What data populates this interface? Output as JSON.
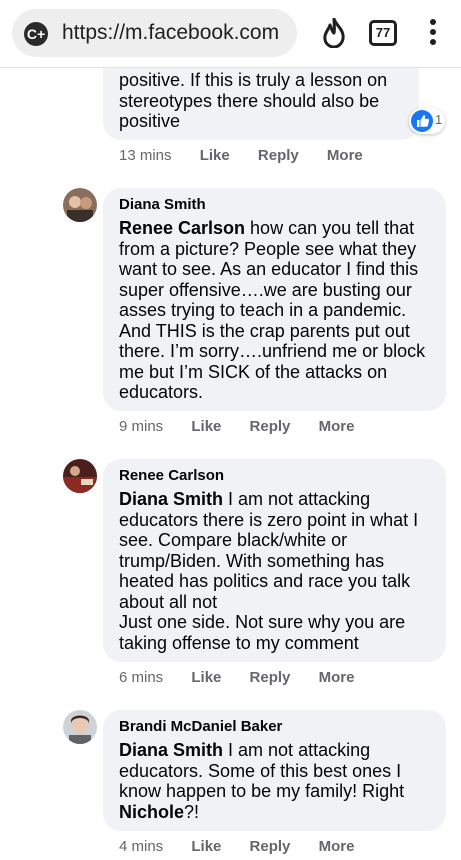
{
  "browser": {
    "site_badge": "C+",
    "url": "https://m.facebook.com",
    "tab_count": "77",
    "icons": [
      "site-badge-icon",
      "flame-icon",
      "tabs-icon",
      "kebab-menu-icon"
    ]
  },
  "comments": [
    {
      "author": "",
      "lines": [
        "positive. If this is truly a lesson on",
        "stereotypes there should also be",
        "positive"
      ],
      "time": "13 mins",
      "like": "Like",
      "reply": "Reply",
      "more": "More",
      "reaction_count": "1"
    },
    {
      "author": "Diana Smith",
      "mention": "Renee Carlson",
      "lines": [
        " how can you tell that",
        "from a picture? People see what they",
        "want to see. As an educator I find this",
        "super offensive….we are busting our",
        "asses trying to teach in a pandemic.",
        "And THIS is the crap parents put out",
        "there. I’m sorry….unfriend me or block",
        "me but I’m SICK of the attacks on",
        "educators."
      ],
      "time": "9 mins",
      "like": "Like",
      "reply": "Reply",
      "more": "More"
    },
    {
      "author": "Renee Carlson",
      "mention": "Diana Smith",
      "lines": [
        " I am not attacking",
        "educators there is zero point in what I",
        "see. Compare black/white or",
        "trump/Biden. With something has",
        "heated has politics and race you talk",
        "about all not",
        "Just one side. Not sure why you are",
        "taking offense to my comment"
      ],
      "time": "6 mins",
      "like": "Like",
      "reply": "Reply",
      "more": "More"
    },
    {
      "author": "Brandi McDaniel Baker",
      "mention": "Diana Smith",
      "lines": [
        " I am not attacking",
        "educators. Some of this best ones I",
        "know happen to be my family! Right"
      ],
      "last_mention": "Nichole",
      "last_suffix": "?!",
      "time": "4 mins",
      "like": "Like",
      "reply": "Reply",
      "more": "More"
    }
  ],
  "colors": {
    "bubble": "#f0f2f5",
    "meta_text": "#65676b",
    "like_blue": "#1877f2"
  }
}
